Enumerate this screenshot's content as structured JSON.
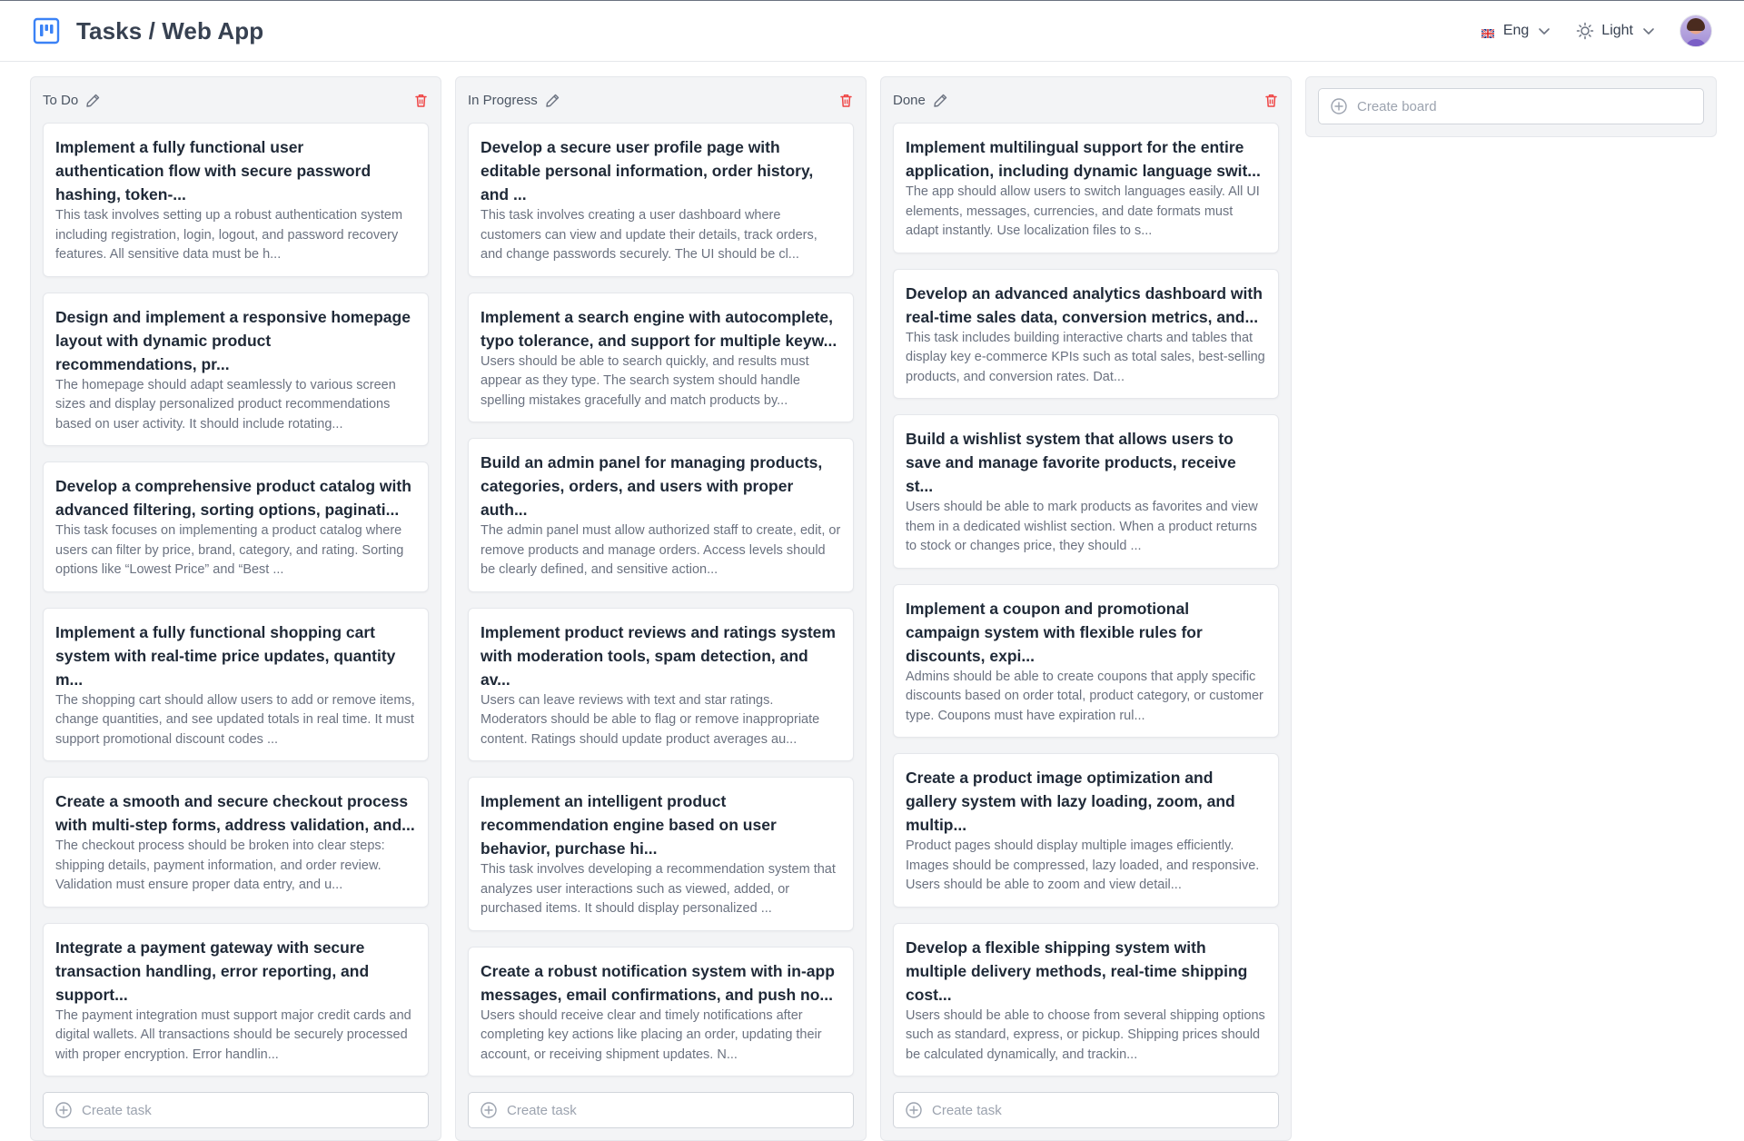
{
  "header": {
    "title": "Tasks / Web App",
    "language": "Eng",
    "theme": "Light",
    "logo_color": "#3b82f6"
  },
  "columns": [
    {
      "name": "To Do",
      "create_task_label": "Create task",
      "cards": [
        {
          "title": "Implement a fully functional user authentication flow with secure password hashing, token-...",
          "desc": "This task involves setting up a robust authentication system including registration, login, logout, and password recovery features. All sensitive data must be h..."
        },
        {
          "title": "Design and implement a responsive homepage layout with dynamic product recommendations, pr...",
          "desc": "The homepage should adapt seamlessly to various screen sizes and display personalized product recommendations based on user activity. It should include rotating..."
        },
        {
          "title": "Develop a comprehensive product catalog with advanced filtering, sorting options, paginati...",
          "desc": "This task focuses on implementing a product catalog where users can filter by price, brand, category, and rating. Sorting options like “Lowest Price” and “Best ..."
        },
        {
          "title": "Implement a fully functional shopping cart system with real-time price updates, quantity m...",
          "desc": "The shopping cart should allow users to add or remove items, change quantities, and see updated totals in real time. It must support promotional discount codes ..."
        },
        {
          "title": "Create a smooth and secure checkout process with multi-step forms, address validation, and...",
          "desc": "The checkout process should be broken into clear steps: shipping details, payment information, and order review. Validation must ensure proper data entry, and u..."
        },
        {
          "title": "Integrate a payment gateway with secure transaction handling, error reporting, and support...",
          "desc": "The payment integration must support major credit cards and digital wallets. All transactions should be securely processed with proper encryption. Error handlin..."
        }
      ]
    },
    {
      "name": "In Progress",
      "create_task_label": "Create task",
      "cards": [
        {
          "title": "Develop a secure user profile page with editable personal information, order history, and ...",
          "desc": "This task involves creating a user dashboard where customers can view and update their details, track orders, and change passwords securely. The UI should be cl..."
        },
        {
          "title": "Implement a search engine with autocomplete, typo tolerance, and support for multiple keyw...",
          "desc": "Users should be able to search quickly, and results must appear as they type. The search system should handle spelling mistakes gracefully and match products by..."
        },
        {
          "title": "Build an admin panel for managing products, categories, orders, and users with proper auth...",
          "desc": "The admin panel must allow authorized staff to create, edit, or remove products and manage orders. Access levels should be clearly defined, and sensitive action..."
        },
        {
          "title": "Implement product reviews and ratings system with moderation tools, spam detection, and av...",
          "desc": "Users can leave reviews with text and star ratings. Moderators should be able to flag or remove inappropriate content. Ratings should update product averages au..."
        },
        {
          "title": "Implement an intelligent product recommendation engine based on user behavior, purchase hi...",
          "desc": "This task involves developing a recommendation system that analyzes user interactions such as viewed, added, or purchased items. It should display personalized ..."
        },
        {
          "title": "Create a robust notification system with in-app messages, email confirmations, and push no...",
          "desc": "Users should receive clear and timely notifications after completing key actions like placing an order, updating their account, or receiving shipment updates. N..."
        }
      ]
    },
    {
      "name": "Done",
      "create_task_label": "Create task",
      "cards": [
        {
          "title": "Implement multilingual support for the entire application, including dynamic language swit...",
          "desc": "The app should allow users to switch languages easily. All UI elements, messages, currencies, and date formats must adapt instantly. Use localization files to s..."
        },
        {
          "title": "Develop an advanced analytics dashboard with real-time sales data, conversion metrics, and...",
          "desc": "This task includes building interactive charts and tables that display key e-commerce KPIs such as total sales, best-selling products, and conversion rates. Dat..."
        },
        {
          "title": "Build a wishlist system that allows users to save and manage favorite products, receive st...",
          "desc": "Users should be able to mark products as favorites and view them in a dedicated wishlist section. When a product returns to stock or changes price, they should ..."
        },
        {
          "title": "Implement a coupon and promotional campaign system with flexible rules for discounts, expi...",
          "desc": "Admins should be able to create coupons that apply specific discounts based on order total, product category, or customer type. Coupons must have expiration rul..."
        },
        {
          "title": "Create a product image optimization and gallery system with lazy loading, zoom, and multip...",
          "desc": "Product pages should display multiple images efficiently. Images should be compressed, lazy loaded, and responsive. Users should be able to zoom and view detail..."
        },
        {
          "title": "Develop a flexible shipping system with multiple delivery methods, real-time shipping cost...",
          "desc": "Users should be able to choose from several shipping options such as standard, express, or pickup. Shipping prices should be calculated dynamically, and trackin..."
        }
      ]
    }
  ],
  "create_board_label": "Create board",
  "colors": {
    "trash": "#ef4444",
    "accent": "#3b82f6"
  }
}
